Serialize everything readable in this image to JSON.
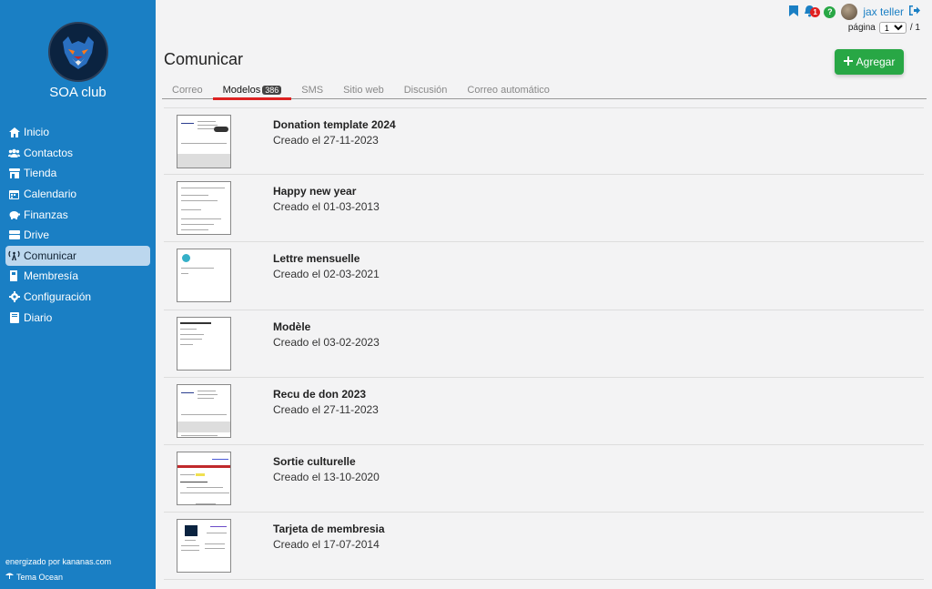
{
  "sidebar": {
    "club_name": "SOA club",
    "items": [
      {
        "label": "Inicio",
        "icon": "home-icon"
      },
      {
        "label": "Contactos",
        "icon": "users-icon"
      },
      {
        "label": "Tienda",
        "icon": "store-icon"
      },
      {
        "label": "Calendario",
        "icon": "calendar-icon"
      },
      {
        "label": "Finanzas",
        "icon": "piggy-bank-icon"
      },
      {
        "label": "Drive",
        "icon": "drive-icon"
      },
      {
        "label": "Comunicar",
        "icon": "broadcast-icon",
        "active": true
      },
      {
        "label": "Membresía",
        "icon": "id-card-icon"
      },
      {
        "label": "Configuración",
        "icon": "gear-icon"
      },
      {
        "label": "Diario",
        "icon": "book-icon"
      }
    ],
    "powered": "energizado por kananas.com",
    "theme": "Tema Ocean"
  },
  "topbar": {
    "notifications": "1",
    "help": "?",
    "username": "jax teller",
    "page_label": "página",
    "page_value": "1",
    "page_total": "/ 1"
  },
  "page": {
    "title": "Comunicar",
    "add_label": "Agregar"
  },
  "tabs": [
    {
      "label": "Correo"
    },
    {
      "label": "Modelos",
      "count": "386",
      "active": true
    },
    {
      "label": "SMS"
    },
    {
      "label": "Sitio web"
    },
    {
      "label": "Discusión"
    },
    {
      "label": "Correo automático"
    }
  ],
  "templates": [
    {
      "title": "Donation template 2024",
      "date": "Creado el 27-11-2023"
    },
    {
      "title": "Happy new year",
      "date": "Creado el 01-03-2013"
    },
    {
      "title": "Lettre mensuelle",
      "date": "Creado el 02-03-2021"
    },
    {
      "title": "Modèle",
      "date": "Creado el 03-02-2023"
    },
    {
      "title": "Recu de don 2023",
      "date": "Creado el 27-11-2023"
    },
    {
      "title": "Sortie culturelle",
      "date": "Creado el 13-10-2020"
    },
    {
      "title": "Tarjeta de membresia",
      "date": "Creado el 17-07-2014"
    }
  ],
  "colors": {
    "sidebar": "#1a7fc4",
    "accent_green": "#28a745",
    "active_tab_underline": "#dd2222"
  }
}
